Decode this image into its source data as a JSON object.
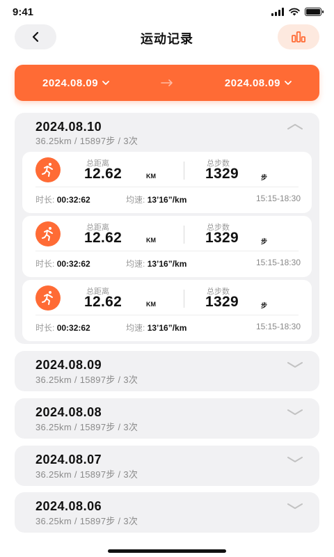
{
  "status": {
    "time": "9:41"
  },
  "nav": {
    "title": "运动记录",
    "back_icon": "chevron-left-icon",
    "chart_icon": "bar-chart-icon"
  },
  "range": {
    "start": "2024.08.09",
    "end": "2024.08.09"
  },
  "colors": {
    "accent": "#ff6b35",
    "accent_soft": "#fde9df",
    "card_bg": "#f1f1f3"
  },
  "groups": [
    {
      "date": "2024.08.10",
      "summary": "36.25km  / 15897步  /  3次",
      "expanded": true,
      "records": [
        {
          "distance_label": "总距离",
          "distance": "12.62",
          "distance_unit": "KM",
          "steps_label": "总步数",
          "steps": "1329",
          "steps_unit": "步",
          "duration_key": "时长:",
          "duration": "00:32:62",
          "pace_key": "均速:",
          "pace": "13’16”/km",
          "time_range": "15:15-18:30"
        },
        {
          "distance_label": "总距离",
          "distance": "12.62",
          "distance_unit": "KM",
          "steps_label": "总步数",
          "steps": "1329",
          "steps_unit": "步",
          "duration_key": "时长:",
          "duration": "00:32:62",
          "pace_key": "均速:",
          "pace": "13’16”/km",
          "time_range": "15:15-18:30"
        },
        {
          "distance_label": "总距离",
          "distance": "12.62",
          "distance_unit": "KM",
          "steps_label": "总步数",
          "steps": "1329",
          "steps_unit": "步",
          "duration_key": "时长:",
          "duration": "00:32:62",
          "pace_key": "均速:",
          "pace": "13’16”/km",
          "time_range": "15:15-18:30"
        }
      ]
    },
    {
      "date": "2024.08.09",
      "summary": "36.25km  / 15897步  /  3次",
      "expanded": false
    },
    {
      "date": "2024.08.08",
      "summary": "36.25km  / 15897步  /  3次",
      "expanded": false
    },
    {
      "date": "2024.08.07",
      "summary": "36.25km  / 15897步  /  3次",
      "expanded": false
    },
    {
      "date": "2024.08.06",
      "summary": "36.25km  / 15897步  /  3次",
      "expanded": false
    }
  ]
}
